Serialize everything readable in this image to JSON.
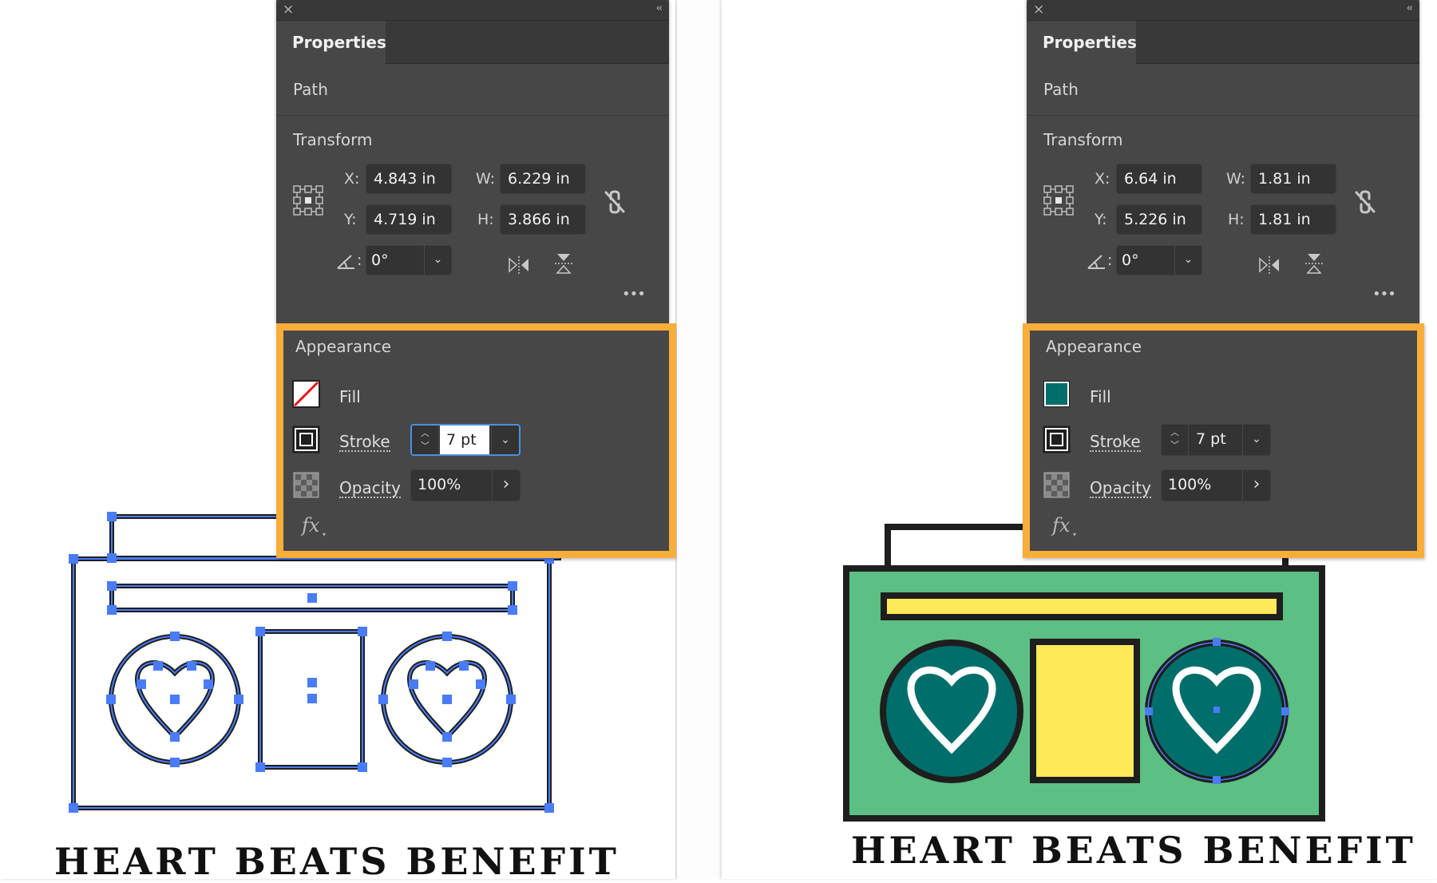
{
  "left": {
    "panel": {
      "close_icon": "×",
      "collapse_icon": "‹‹",
      "tab": "Properties",
      "object_type": "Path",
      "transform": {
        "title": "Transform",
        "x_label": "X:",
        "x_value": "4.843 in",
        "y_label": "Y:",
        "y_value": "4.719 in",
        "w_label": "W:",
        "w_value": "6.229 in",
        "h_label": "H:",
        "h_value": "3.866 in",
        "angle_label": ":",
        "angle_value": "0°"
      },
      "more_icon": "•••",
      "appearance": {
        "title": "Appearance",
        "fill_label": "Fill",
        "fill_color": "none",
        "stroke_label": "Stroke",
        "stroke_value": "7 pt",
        "stroke_focused": true,
        "opacity_label": "Opacity",
        "opacity_value": "100%",
        "fx_label": "fx"
      }
    },
    "artwork": {
      "title": "HEART BEATS BENEFIT",
      "mode": "outline-selected"
    }
  },
  "right": {
    "panel": {
      "close_icon": "×",
      "collapse_icon": "‹‹",
      "tab": "Properties",
      "object_type": "Path",
      "transform": {
        "title": "Transform",
        "x_label": "X:",
        "x_value": "6.64 in",
        "y_label": "Y:",
        "y_value": "5.226 in",
        "w_label": "W:",
        "w_value": "1.81 in",
        "h_label": "H:",
        "h_value": "1.81 in",
        "angle_label": ":",
        "angle_value": "0°"
      },
      "more_icon": "•••",
      "appearance": {
        "title": "Appearance",
        "fill_label": "Fill",
        "fill_color": "#006e6b",
        "stroke_label": "Stroke",
        "stroke_value": "7 pt",
        "stroke_focused": false,
        "opacity_label": "Opacity",
        "opacity_value": "100%",
        "fx_label": "fx"
      }
    },
    "artwork": {
      "title": "HEART BEATS BENEFIT",
      "mode": "colored"
    }
  },
  "colors": {
    "highlight": "#f9ad3a",
    "selection": "#4a7cf7",
    "body_green": "#5cbf84",
    "speaker_teal": "#006e6b",
    "yellow": "#fde95a",
    "outline": "#1e1e1e"
  },
  "dropdown_icon": "⌄",
  "chevron_right_icon": "›"
}
